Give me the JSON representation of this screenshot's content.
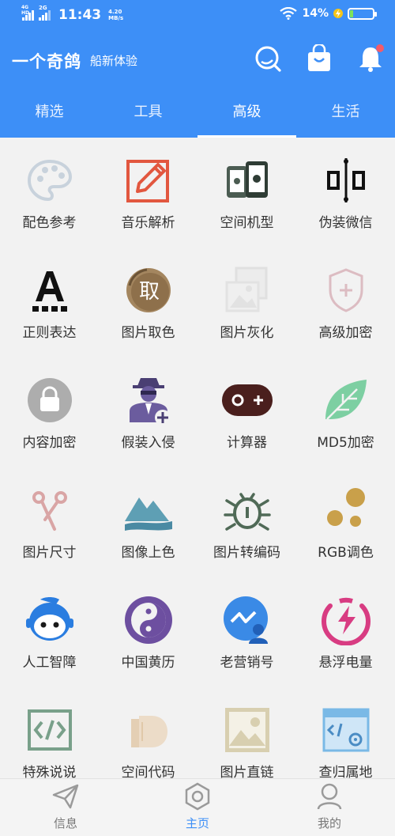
{
  "status_bar": {
    "network1": "4G HD",
    "network2": "2G",
    "time": "11:43",
    "speed_value": "4.20",
    "speed_unit": "MB/s",
    "battery": "14%"
  },
  "header": {
    "title": "一个奇鸽",
    "subtitle": "船新体验",
    "icons": [
      "search-icon",
      "shopping-bag-icon",
      "bell-icon"
    ]
  },
  "tabs": [
    {
      "label": "精选"
    },
    {
      "label": "工具"
    },
    {
      "label": "高级"
    },
    {
      "label": "生活"
    }
  ],
  "active_tab": "高级",
  "grid": [
    {
      "label": "配色参考",
      "icon": "palette-icon"
    },
    {
      "label": "音乐解析",
      "icon": "pencil-icon"
    },
    {
      "label": "空间机型",
      "icon": "phones-icon"
    },
    {
      "label": "伪装微信",
      "icon": "align-icon"
    },
    {
      "label": "正则表达",
      "icon": "letter-a-icon"
    },
    {
      "label": "图片取色",
      "icon": "take-color-icon"
    },
    {
      "label": "图片灰化",
      "icon": "gray-image-icon"
    },
    {
      "label": "高级加密",
      "icon": "shield-plus-icon"
    },
    {
      "label": "内容加密",
      "icon": "lock-icon"
    },
    {
      "label": "假装入侵",
      "icon": "hacker-icon"
    },
    {
      "label": "计算器",
      "icon": "calculator-icon"
    },
    {
      "label": "MD5加密",
      "icon": "leaf-icon"
    },
    {
      "label": "图片尺寸",
      "icon": "scissors-icon"
    },
    {
      "label": "图像上色",
      "icon": "mountain-icon"
    },
    {
      "label": "图片转编码",
      "icon": "bug-icon"
    },
    {
      "label": "RGB调色",
      "icon": "dots-icon"
    },
    {
      "label": "人工智障",
      "icon": "robot-icon"
    },
    {
      "label": "中国黄历",
      "icon": "yinyang-icon"
    },
    {
      "label": "老营销号",
      "icon": "chart-user-icon"
    },
    {
      "label": "悬浮电量",
      "icon": "battery-bolt-icon"
    },
    {
      "label": "特殊说说",
      "icon": "code-icon"
    },
    {
      "label": "空间代码",
      "icon": "hand-icon"
    },
    {
      "label": "图片直链",
      "icon": "picture-icon"
    },
    {
      "label": "查归属地",
      "icon": "browser-gear-icon"
    }
  ],
  "bottom_nav": [
    {
      "label": "信息",
      "icon": "paper-plane-icon"
    },
    {
      "label": "主页",
      "icon": "hexagon-icon"
    },
    {
      "label": "我的",
      "icon": "person-icon"
    }
  ],
  "colors": {
    "primary": "#3d8ff7",
    "background": "#f2f2f2",
    "text": "#333333"
  }
}
